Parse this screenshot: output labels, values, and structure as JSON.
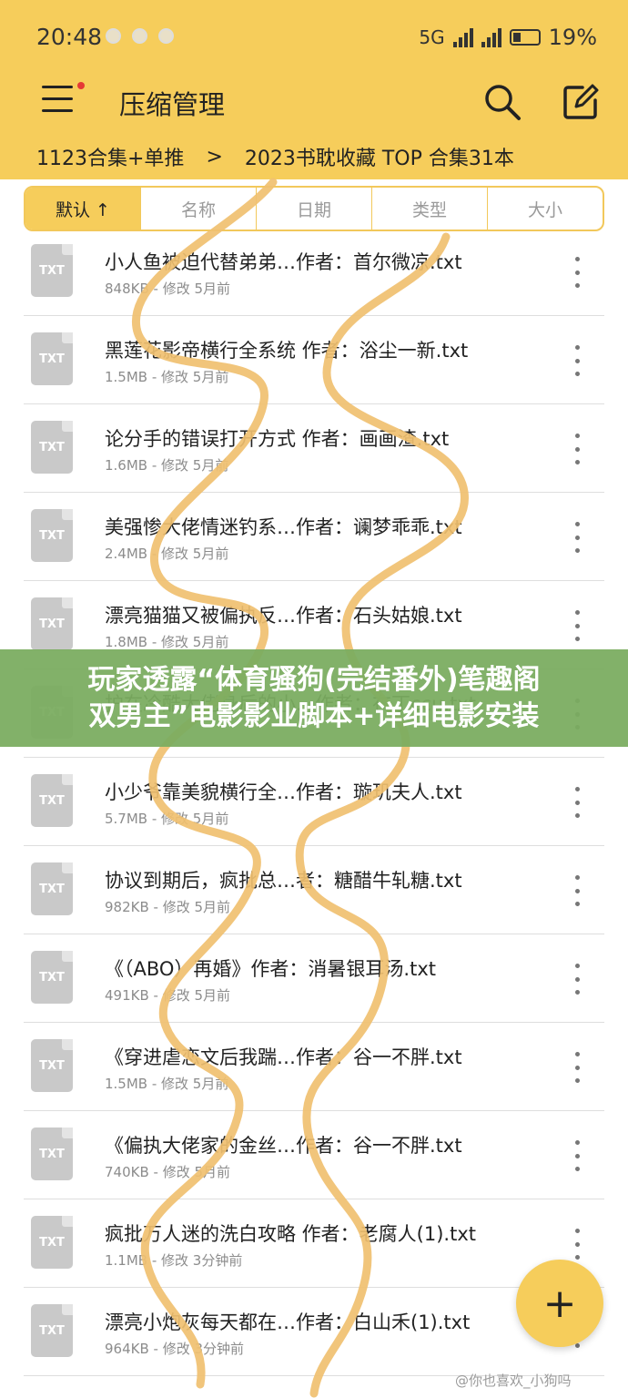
{
  "status_bar": {
    "time": "20:48",
    "network": "5G",
    "battery": "19%"
  },
  "header": {
    "title": "压缩管理"
  },
  "breadcrumb": {
    "parent": "1123合集+单推",
    "separator": ">",
    "current": "2023书耽收藏 TOP 合集31本"
  },
  "sort_tabs": [
    "默认 ↑",
    "名称",
    "日期",
    "类型",
    "大小"
  ],
  "file_icon_label": "TXT",
  "files": [
    {
      "name": "小人鱼被迫代替弟弟…作者：首尔微凉.txt",
      "meta": "848KB - 修改 5月前"
    },
    {
      "name": "黑莲花影帝横行全系统 作者：浴尘一新.txt",
      "meta": "1.5MB - 修改 5月前"
    },
    {
      "name": "论分手的错误打开方式 作者：画画渣.txt",
      "meta": "1.6MB - 修改 5月前"
    },
    {
      "name": "美强惨大佬情迷钓系…作者：谰梦乖乖.txt",
      "meta": "2.4MB - 修改 5月前"
    },
    {
      "name": "漂亮猫猫又被偏执反…作者：石头姑娘.txt",
      "meta": "1.8MB - 修改 5月前"
    },
    {
      "name": "护在冷酷大佬身后的小…作者：布丁ccu.txt",
      "meta": ""
    },
    {
      "name": "小少爷靠美貌横行全…作者：璇玑夫人.txt",
      "meta": "5.7MB - 修改 5月前"
    },
    {
      "name": "协议到期后，疯批总…者：糖醋牛轧糖.txt",
      "meta": "982KB - 修改 5月前"
    },
    {
      "name": "《（ABO）再婚》作者：消暑银耳汤.txt",
      "meta": "491KB - 修改 5月前"
    },
    {
      "name": "《穿进虐恋文后我踹…作者：谷一不胖.txt",
      "meta": "1.5MB - 修改 5月前"
    },
    {
      "name": "《偏执大佬家的金丝…作者：谷一不胖.txt",
      "meta": "740KB - 修改 5月前"
    },
    {
      "name": "疯批万人迷的洗白攻略 作者：老腐人(1).txt",
      "meta": "1.1MB - 修改 3分钟前"
    },
    {
      "name": "漂亮小炮灰每天都在…作者：白山禾(1).txt",
      "meta": "964KB - 修改 3分钟前"
    }
  ],
  "banner": {
    "line1": "玩家透露“体育骚狗(完结番外)笔趣阁",
    "line2": "双男主”电影影业脚本+详细电影安装"
  },
  "fab_label": "+",
  "watermark": "@你也喜欢_小狗吗",
  "colors": {
    "accent": "#f6cd5b",
    "banner": "#7aac60",
    "doodle": "#f0c070"
  }
}
